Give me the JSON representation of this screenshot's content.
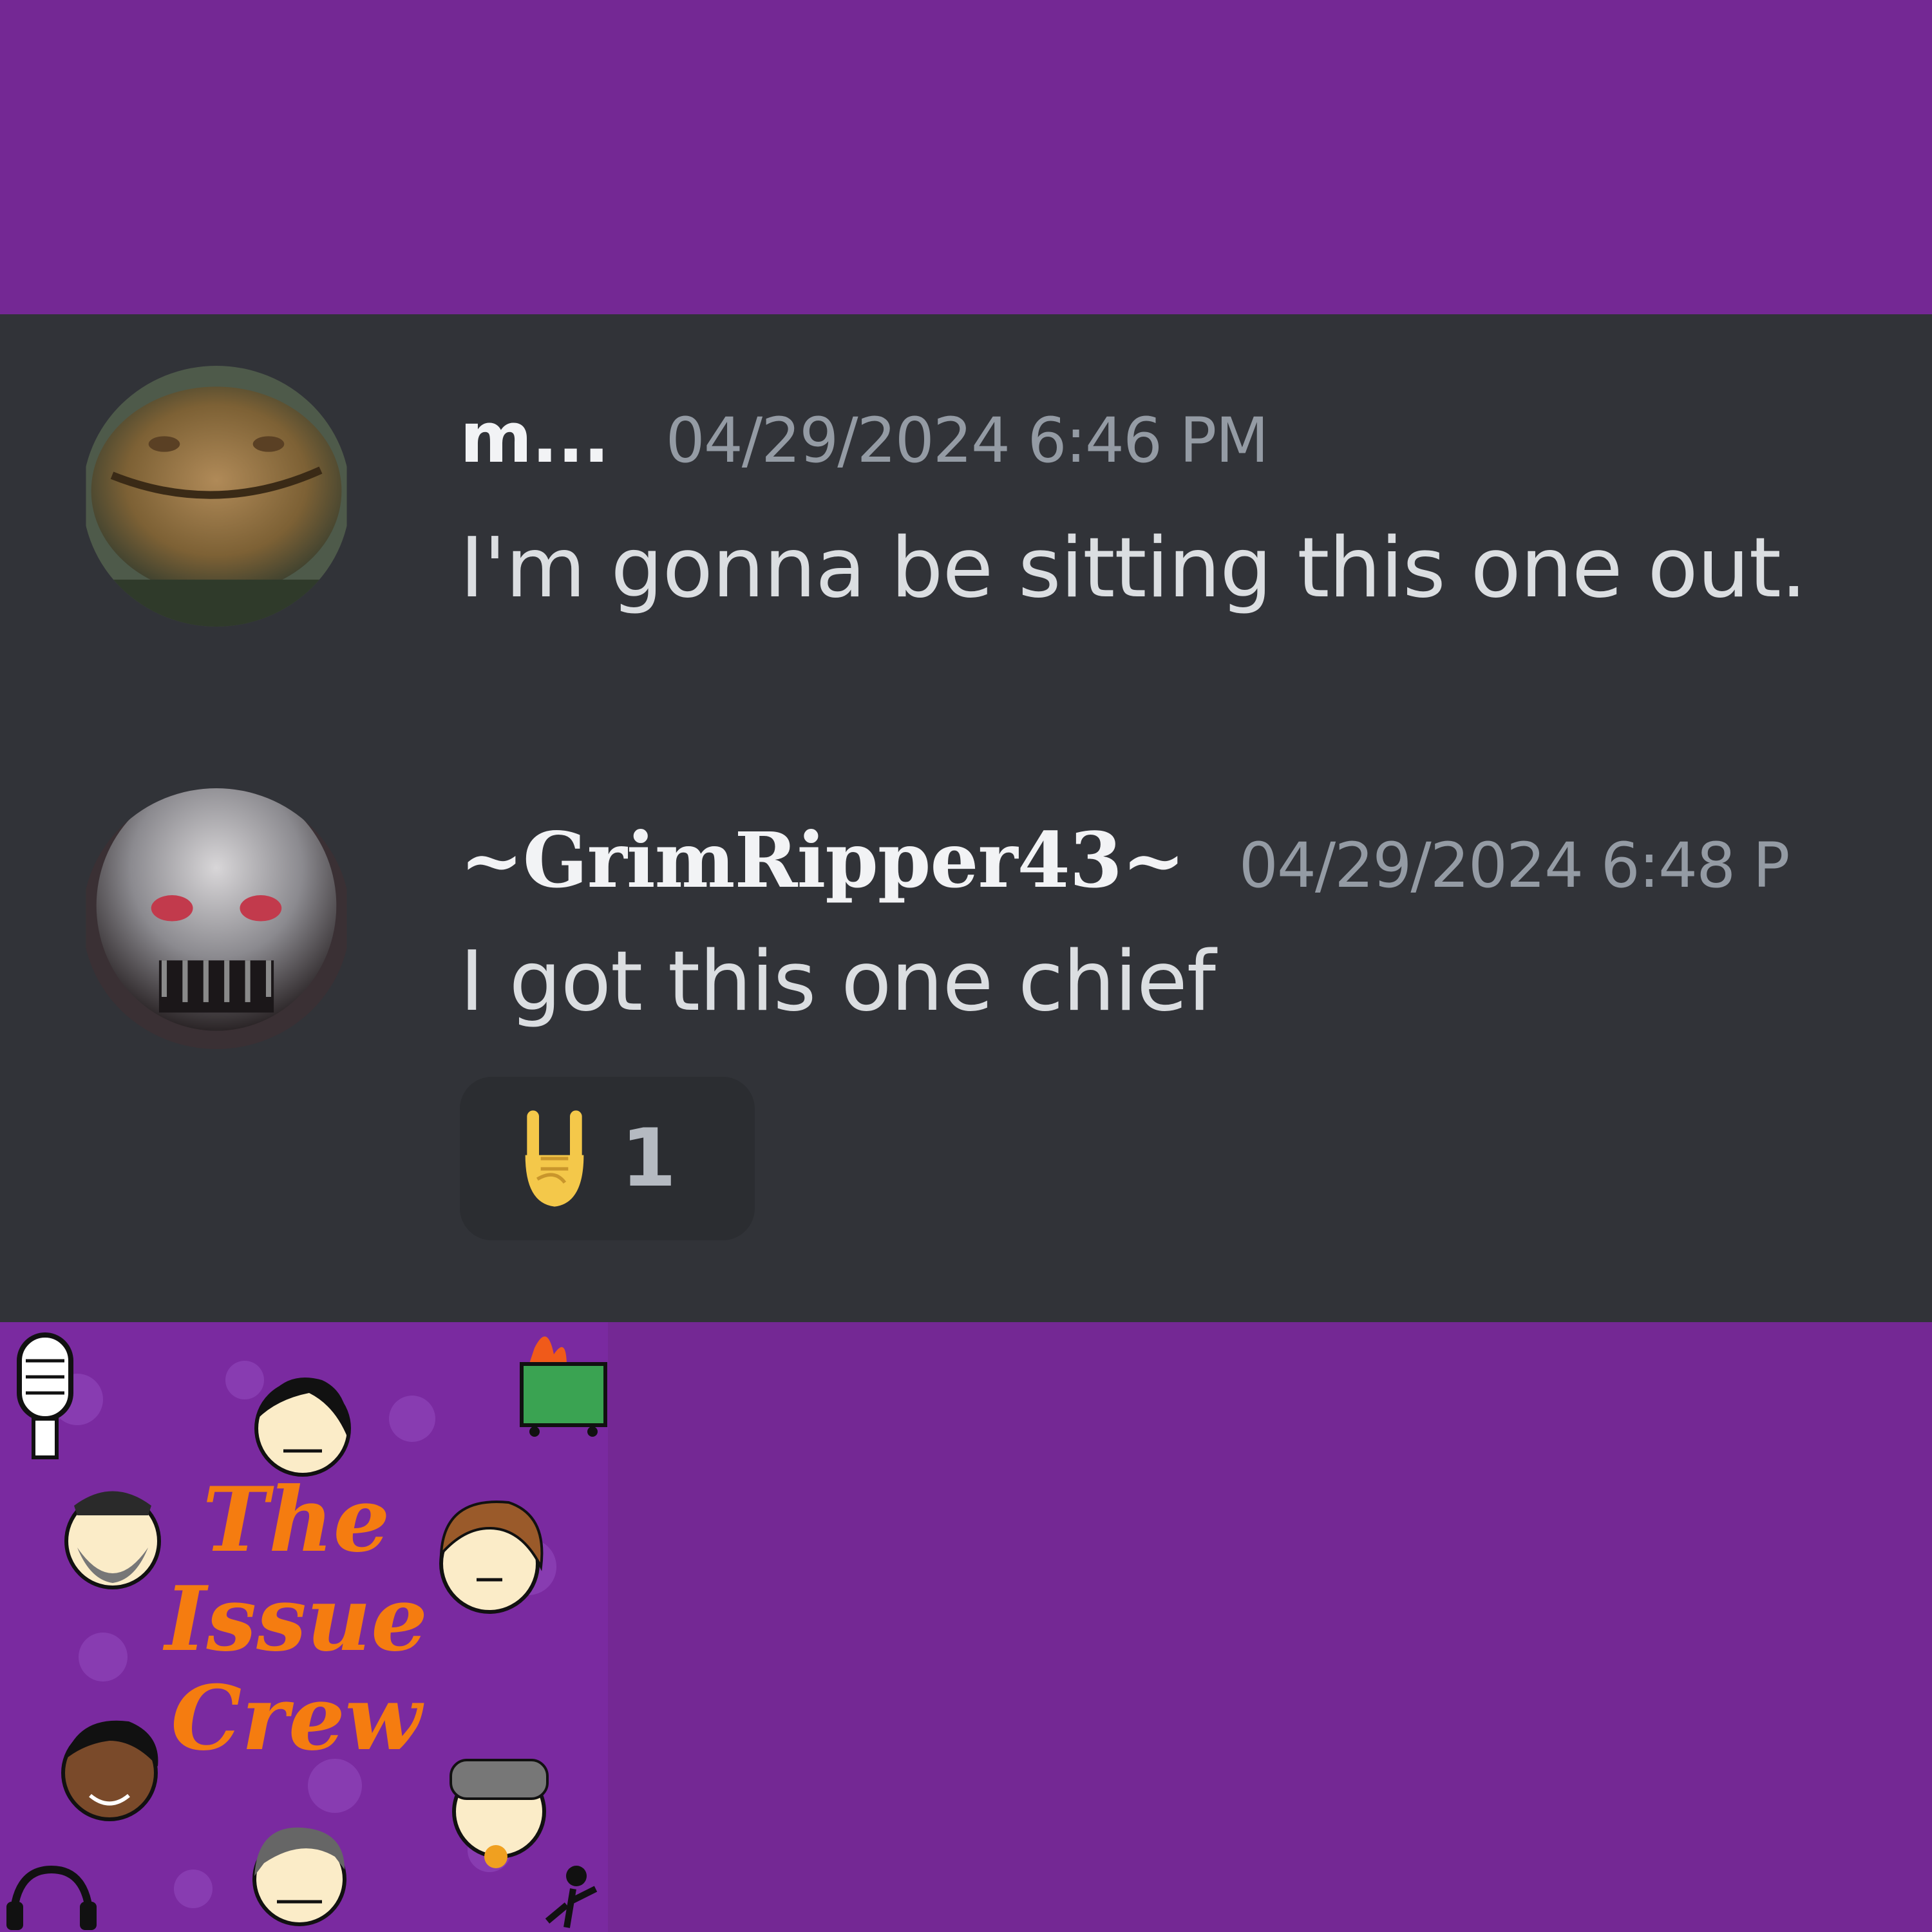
{
  "messages": [
    {
      "username": "m...",
      "timestamp": "04/29/2024 6:46 PM",
      "text": "I'm gonna be sitting this one out."
    },
    {
      "username": "~GrimRipper43~",
      "timestamp": "04/29/2024 6:48 P",
      "text": "I got this one chief",
      "reaction": {
        "emoji": "sign-of-horns",
        "count": "1"
      }
    }
  ],
  "logo": {
    "line1": "The",
    "line2": "Issue",
    "line3": "Crew"
  },
  "colors": {
    "frame": "#742894",
    "chat_bg": "#313338",
    "reaction_bg": "#2b2d31",
    "username": "#f2f3f5",
    "timestamp": "#949ba4",
    "logo_text": "#f57c10"
  }
}
